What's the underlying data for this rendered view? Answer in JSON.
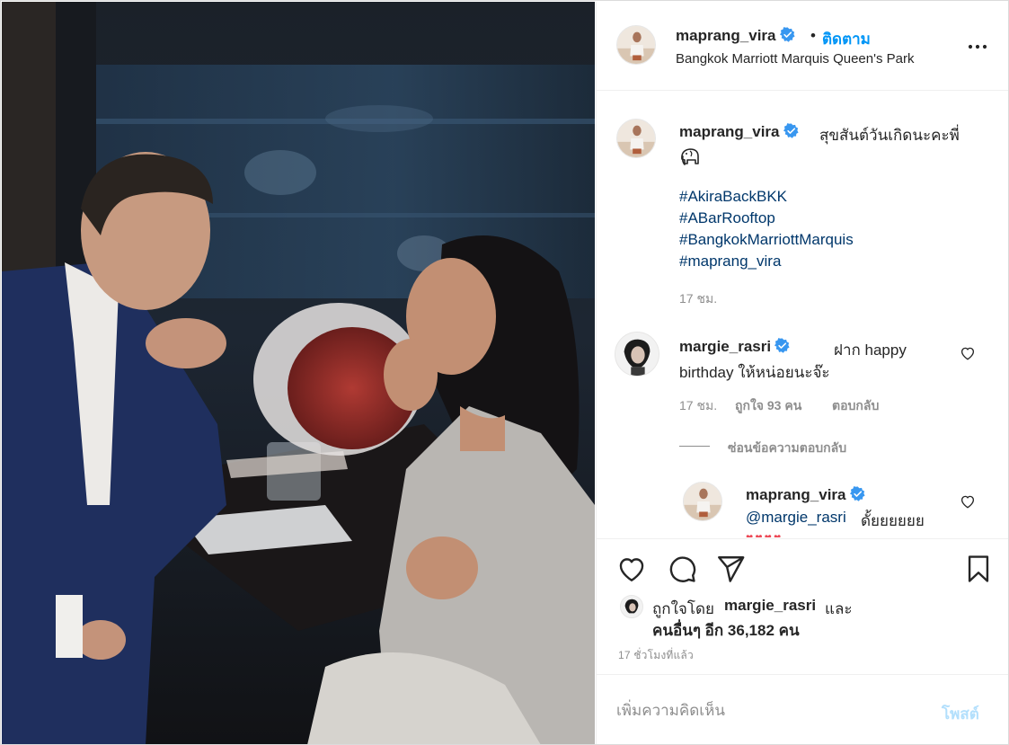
{
  "colors": {
    "link": "#00376b",
    "follow": "#0095f6",
    "muted": "#8e8e8e",
    "verified": "#3897f0",
    "post_disabled": "#b2dffc"
  },
  "icons": {
    "verified": "verified-badge-icon",
    "more": "more-options-icon",
    "like": "heart-icon",
    "comment": "comment-bubble-icon",
    "share": "paper-plane-icon",
    "save": "bookmark-icon",
    "comment_like": "small-heart-icon"
  },
  "header": {
    "username": "maprang_vira",
    "dot": "•",
    "follow_label": "ติดตาม",
    "location": "Bangkok Marriott Marquis Queen's Park"
  },
  "caption": {
    "username": "maprang_vira",
    "text": "สุขสันต์วันเกิดนะคะพี่",
    "emoji": "elephant-emoji",
    "hashtags": [
      "#AkiraBackBKK",
      "#ABarRooftop",
      "#BangkokMarriottMarquis",
      "#maprang_vira"
    ],
    "time": "17 ชม."
  },
  "comment": {
    "username": "margie_rasri",
    "text_line1": "ฝาก happy",
    "text_line2": "birthday ให้หน่อยนะจ๊ะ",
    "time": "17 ชม.",
    "likes": "ถูกใจ 93 คน",
    "reply_label": "ตอบกลับ",
    "hide_replies_label": "ซ่อนข้อความตอบกลับ"
  },
  "reply": {
    "username": "maprang_vira",
    "mention": "@margie_rasri",
    "text": "ดั้ยยยยยย",
    "hearts": "♥♥♥♥"
  },
  "likes": {
    "prefix": "ถูกใจโดย",
    "username": "margie_rasri",
    "and": "และ",
    "others": "คนอื่นๆ อีก 36,182 คน"
  },
  "post_time": "17 ชั่วโมงที่แล้ว",
  "add_comment": {
    "placeholder": "เพิ่มความคิดเห็น",
    "post_label": "โพสต์"
  }
}
